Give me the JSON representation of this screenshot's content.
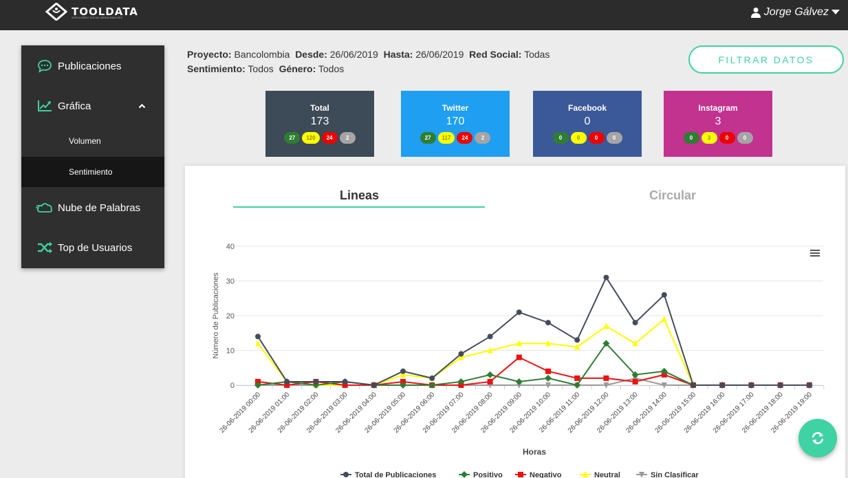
{
  "header": {
    "logo_text": "TOOLDATA",
    "logo_sub": "INTELLIGENT SOCIAL MEDIA ANALYSIS",
    "user_name": "Jorge Gálvez",
    "icons": [
      "shield-logo-icon",
      "user-icon",
      "caret-down-icon"
    ]
  },
  "sidebar": {
    "items": [
      {
        "label": "Publicaciones",
        "icon": "chat-bubble-icon"
      },
      {
        "label": "Gráfica",
        "icon": "line-chart-icon"
      },
      {
        "label": "Volumen"
      },
      {
        "label": "Sentimiento"
      },
      {
        "label": "Nube de Palabras",
        "icon": "cloud-icon"
      },
      {
        "label": "Top de Usuarios",
        "icon": "shuffle-icon"
      }
    ]
  },
  "filters": {
    "proyecto_label": "Proyecto:",
    "proyecto": "Bancolombia",
    "desde_label": "Desde:",
    "desde": "26/06/2019",
    "hasta_label": "Hasta:",
    "hasta": "26/06/2019",
    "red_label": "Red Social:",
    "red": "Todas",
    "sentimiento_label": "Sentimiento:",
    "sentimiento": "Todos",
    "genero_label": "Género:",
    "genero": "Todos",
    "button_label": "FILTRAR DATOS"
  },
  "cards": [
    {
      "title": "Total",
      "value": "173",
      "pos": "27",
      "neu": "120",
      "neg": "24",
      "sin": "2",
      "color": "#3d4a57"
    },
    {
      "title": "Twitter",
      "value": "170",
      "pos": "27",
      "neu": "117",
      "neg": "24",
      "sin": "2",
      "color": "#1e9ff2"
    },
    {
      "title": "Facebook",
      "value": "0",
      "pos": "0",
      "neu": "0",
      "neg": "0",
      "sin": "0",
      "color": "#3b5998"
    },
    {
      "title": "Instagram",
      "value": "3",
      "pos": "0",
      "neu": "3",
      "neg": "0",
      "sin": "0",
      "color": "#c2328f"
    }
  ],
  "tabs": {
    "lineas": "Lineas",
    "circular": "Circular",
    "active": "Lineas"
  },
  "colors": {
    "accent": "#3fd2a2",
    "sidebar": "#2f2f2f",
    "topbar": "#2c2c2c"
  },
  "chart_data": {
    "type": "line",
    "xlabel": "Horas",
    "ylabel": "Número de Publicaciones",
    "ylim": [
      0,
      40
    ],
    "yticks": [
      "0",
      "10",
      "20",
      "30",
      "40"
    ],
    "grid": true,
    "legend_position": "bottom",
    "categories": [
      "26-06-2019 00:00",
      "26-06-2019 01:00",
      "26-06-2019 02:00",
      "26-06-2019 03:00",
      "26-06-2019 04:00",
      "26-06-2019 05:00",
      "26-06-2019 06:00",
      "26-06-2019 07:00",
      "26-06-2019 08:00",
      "26-06-2019 09:00",
      "26-06-2019 10:00",
      "26-06-2019 11:00",
      "26-06-2019 12:00",
      "26-06-2019 13:00",
      "26-06-2019 14:00",
      "26-06-2019 15:00",
      "26-06-2019 16:00",
      "26-06-2019 17:00",
      "26-06-2019 18:00",
      "26-06-2019 19:00"
    ],
    "series": [
      {
        "name": "Total de Publicaciones",
        "color": "#434d5a",
        "marker": "circle",
        "values": [
          14,
          1,
          1,
          1,
          0,
          4,
          2,
          9,
          14,
          21,
          18,
          13,
          31,
          18,
          26,
          0,
          0,
          0,
          0,
          0
        ]
      },
      {
        "name": "Positivo",
        "color": "#2e7d32",
        "marker": "diamond",
        "values": [
          0,
          1,
          0,
          1,
          0,
          0,
          0,
          1,
          3,
          1,
          2,
          0,
          12,
          3,
          4,
          0,
          0,
          0,
          0,
          0
        ]
      },
      {
        "name": "Negativo",
        "color": "#ee1111",
        "marker": "square",
        "values": [
          1,
          0,
          1,
          0,
          0,
          1,
          0,
          0,
          1,
          8,
          4,
          2,
          2,
          1,
          3,
          0,
          0,
          0,
          0,
          0
        ]
      },
      {
        "name": "Neutral",
        "color": "#ffff00",
        "marker": "triangle",
        "values": [
          12,
          1,
          0,
          0,
          0,
          3,
          2,
          8,
          10,
          12,
          12,
          11,
          17,
          12,
          19,
          0,
          0,
          0,
          0,
          0
        ]
      },
      {
        "name": "Sin Clasificar",
        "color": "#9a9a9a",
        "marker": "triangle-down",
        "values": [
          0,
          0,
          0,
          0,
          0,
          0,
          0,
          0,
          0,
          0,
          0,
          0,
          0,
          2,
          0,
          0,
          0,
          0,
          0,
          0
        ]
      }
    ]
  }
}
